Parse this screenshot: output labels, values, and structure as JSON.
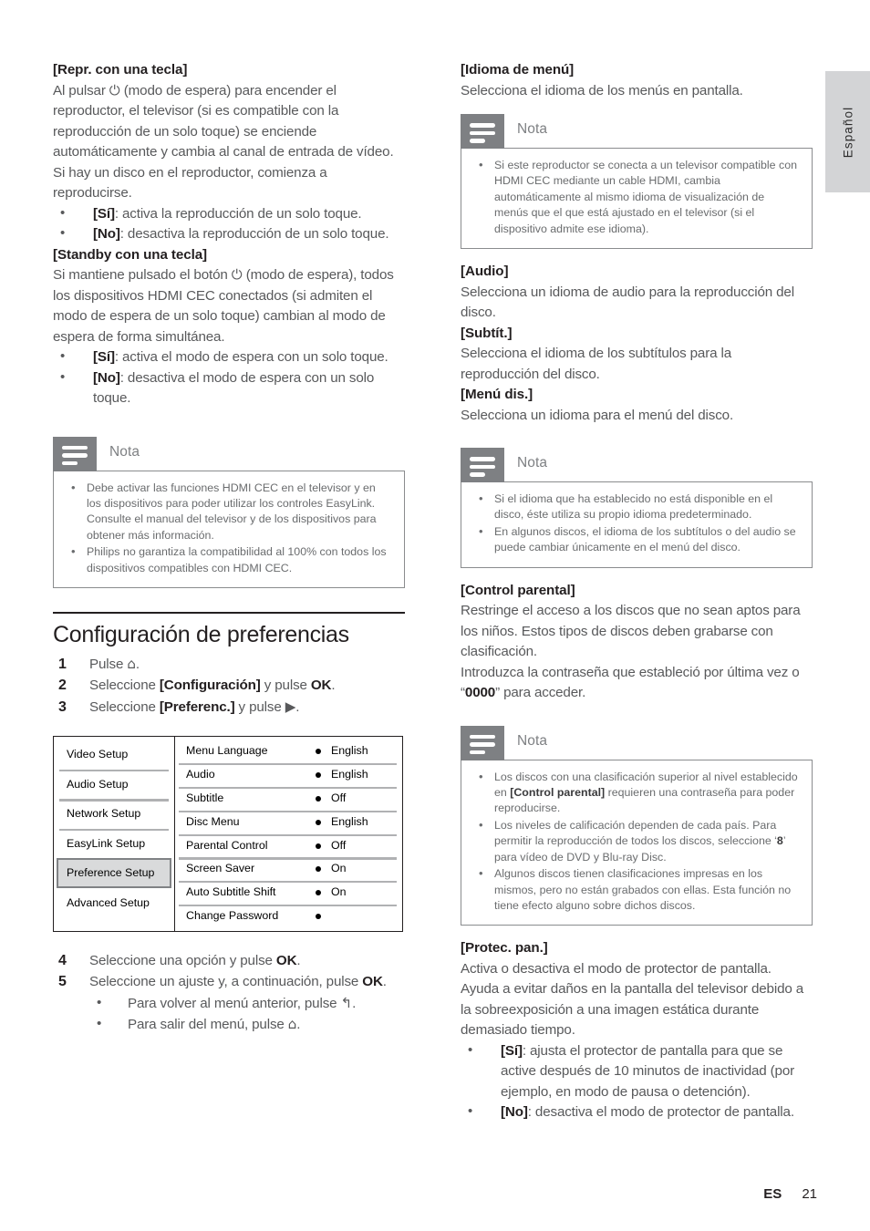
{
  "language_tab": {
    "label": "Español"
  },
  "footer": {
    "locale": "ES",
    "page_number": "21"
  },
  "left_column": {
    "section_one_key": "[Repr. con una tecla]",
    "section_one_body": "Al pulsar ⏻ (modo de espera) para encender el reproductor, el televisor (si es compatible con la reproducción de un solo toque) se enciende automáticamente y cambia al canal de entrada de vídeo. Si hay un disco en el reproductor, comienza a reproducirse.",
    "section_one_bullets": [
      {
        "term": "[Sí]",
        "text": ": activa la reproducción de un solo toque."
      },
      {
        "term": "[No]",
        "text": ": desactiva la reproducción de un solo toque."
      }
    ],
    "section_two_key": "[Standby con una tecla]",
    "section_two_body": "Si mantiene pulsado el botón ⏻ (modo de espera), todos los dispositivos HDMI CEC conectados (si admiten el modo de espera de un solo toque) cambian al modo de espera de forma simultánea.",
    "section_two_bullets": [
      {
        "term": "[Sí]",
        "text": ": activa el modo de espera con un solo toque."
      },
      {
        "term": "[No]",
        "text": ": desactiva el modo de espera con un solo toque."
      }
    ],
    "note": {
      "title": "Nota",
      "items": [
        "Debe activar las funciones HDMI CEC en el televisor y en los dispositivos para poder utilizar los controles EasyLink. Consulte el manual del televisor y de los dispositivos para obtener más información.",
        "Philips no garantiza la compatibilidad al 100% con todos los dispositivos compatibles con HDMI CEC."
      ]
    },
    "section_heading": "Configuración de preferencias",
    "steps": [
      {
        "num": "1",
        "parts": [
          {
            "t": "Pulse "
          },
          {
            "glyph": "⌂"
          },
          {
            "t": "."
          }
        ]
      },
      {
        "num": "2",
        "parts": [
          {
            "t": "Seleccione "
          },
          {
            "b": "[Configuración]"
          },
          {
            "t": " y pulse "
          },
          {
            "b": "OK"
          },
          {
            "t": "."
          }
        ]
      },
      {
        "num": "3",
        "parts": [
          {
            "t": "Seleccione "
          },
          {
            "b": "[Preferenc.]"
          },
          {
            "t": " y pulse "
          },
          {
            "glyph": "▶"
          },
          {
            "t": "."
          }
        ]
      }
    ],
    "steps_after": [
      {
        "num": "4",
        "parts": [
          {
            "t": "Seleccione una opción y pulse "
          },
          {
            "b": "OK"
          },
          {
            "t": "."
          }
        ]
      },
      {
        "num": "5",
        "parts": [
          {
            "t": "Seleccione un ajuste y, a continuación, pulse "
          },
          {
            "b": "OK"
          },
          {
            "t": "."
          }
        ]
      }
    ],
    "substeps": [
      {
        "parts": [
          {
            "t": "Para volver al menú anterior, pulse "
          },
          {
            "glyph": "↰"
          },
          {
            "t": "."
          }
        ]
      },
      {
        "parts": [
          {
            "t": "Para salir del menú, pulse "
          },
          {
            "glyph": "⌂"
          },
          {
            "t": "."
          }
        ]
      }
    ],
    "menu_screenshot": {
      "left_items": [
        {
          "label": "Video Setup",
          "selected": false
        },
        {
          "label": "Audio Setup",
          "selected": false
        },
        {
          "label": "Network Setup",
          "selected": false
        },
        {
          "label": "EasyLink Setup",
          "selected": false
        },
        {
          "label": "Preference Setup",
          "selected": true
        },
        {
          "label": "Advanced Setup",
          "selected": false
        }
      ],
      "right_items": [
        {
          "label": "Menu Language",
          "value": "English"
        },
        {
          "label": "Audio",
          "value": "English"
        },
        {
          "label": "Subtitle",
          "value": "Off"
        },
        {
          "label": "Disc Menu",
          "value": "English"
        },
        {
          "label": "Parental Control",
          "value": "Off"
        },
        {
          "label": "Screen Saver",
          "value": "On"
        },
        {
          "label": "Auto Subtitle Shift",
          "value": "On"
        },
        {
          "label": "Change Password",
          "value": ""
        }
      ]
    }
  },
  "right_column": {
    "menu_lang_key": "[Idioma de menú]",
    "menu_lang_body": "Selecciona el idioma de los menús en pantalla.",
    "note_one": {
      "title": "Nota",
      "items": [
        "Si este reproductor se conecta a un televisor compatible con HDMI CEC mediante un cable HDMI, cambia automáticamente al mismo idioma de visualización de menús que el que está ajustado en el televisor (si el dispositivo admite ese idioma)."
      ]
    },
    "audio_key": "[Audio]",
    "audio_body": "Selecciona un idioma de audio para la reproducción del disco.",
    "subtitle_key": "[Subtít.]",
    "subtitle_body": "Selecciona el idioma de los subtítulos para la reproducción del disco.",
    "discmenu_key": "[Menú dis.]",
    "discmenu_body": "Selecciona un idioma para el menú del disco.",
    "note_two": {
      "title": "Nota",
      "items": [
        "Si el idioma que ha establecido no está disponible en el disco, éste utiliza su propio idioma predeterminado.",
        "En algunos discos, el idioma de los subtítulos o del audio se puede cambiar únicamente en el menú del disco."
      ]
    },
    "parental_key": "[Control parental]",
    "parental_body_1": "Restringe el acceso a los discos que no sean aptos para los niños. Estos tipos de discos deben grabarse con clasificación.",
    "parental_body_2_pre": "Introduzca la contraseña que estableció por última vez o “",
    "parental_password": "0000",
    "parental_body_2_post": "” para acceder.",
    "note_three": {
      "title": "Nota",
      "items": [
        {
          "pre": "Los discos con una clasificación superior al nivel establecido en ",
          "bold": "[Control parental]",
          "post": " requieren una contraseña para poder reproducirse."
        },
        {
          "pre": "Los niveles de calificación dependen de cada país. Para permitir la reproducción de todos los discos, seleccione ‘",
          "bold": "8",
          "post": "’ para vídeo de DVD y Blu-ray Disc."
        },
        {
          "pre": "Algunos discos tienen clasificaciones impresas en los mismos, pero no están grabados con ellas. Esta función no tiene efecto alguno sobre dichos discos.",
          "bold": "",
          "post": ""
        }
      ]
    },
    "screensaver_key": "[Protec. pan.]",
    "screensaver_body": "Activa o desactiva el modo de protector de pantalla. Ayuda a evitar daños en la pantalla del televisor debido a la sobreexposición a una imagen estática durante demasiado tiempo.",
    "screensaver_bullets": [
      {
        "term": "[Sí]",
        "text": ": ajusta el protector de pantalla para que se active después de 10 minutos de inactividad (por ejemplo, en modo de pausa o detención)."
      },
      {
        "term": "[No]",
        "text": ": desactiva el modo de protector de pantalla."
      }
    ]
  }
}
